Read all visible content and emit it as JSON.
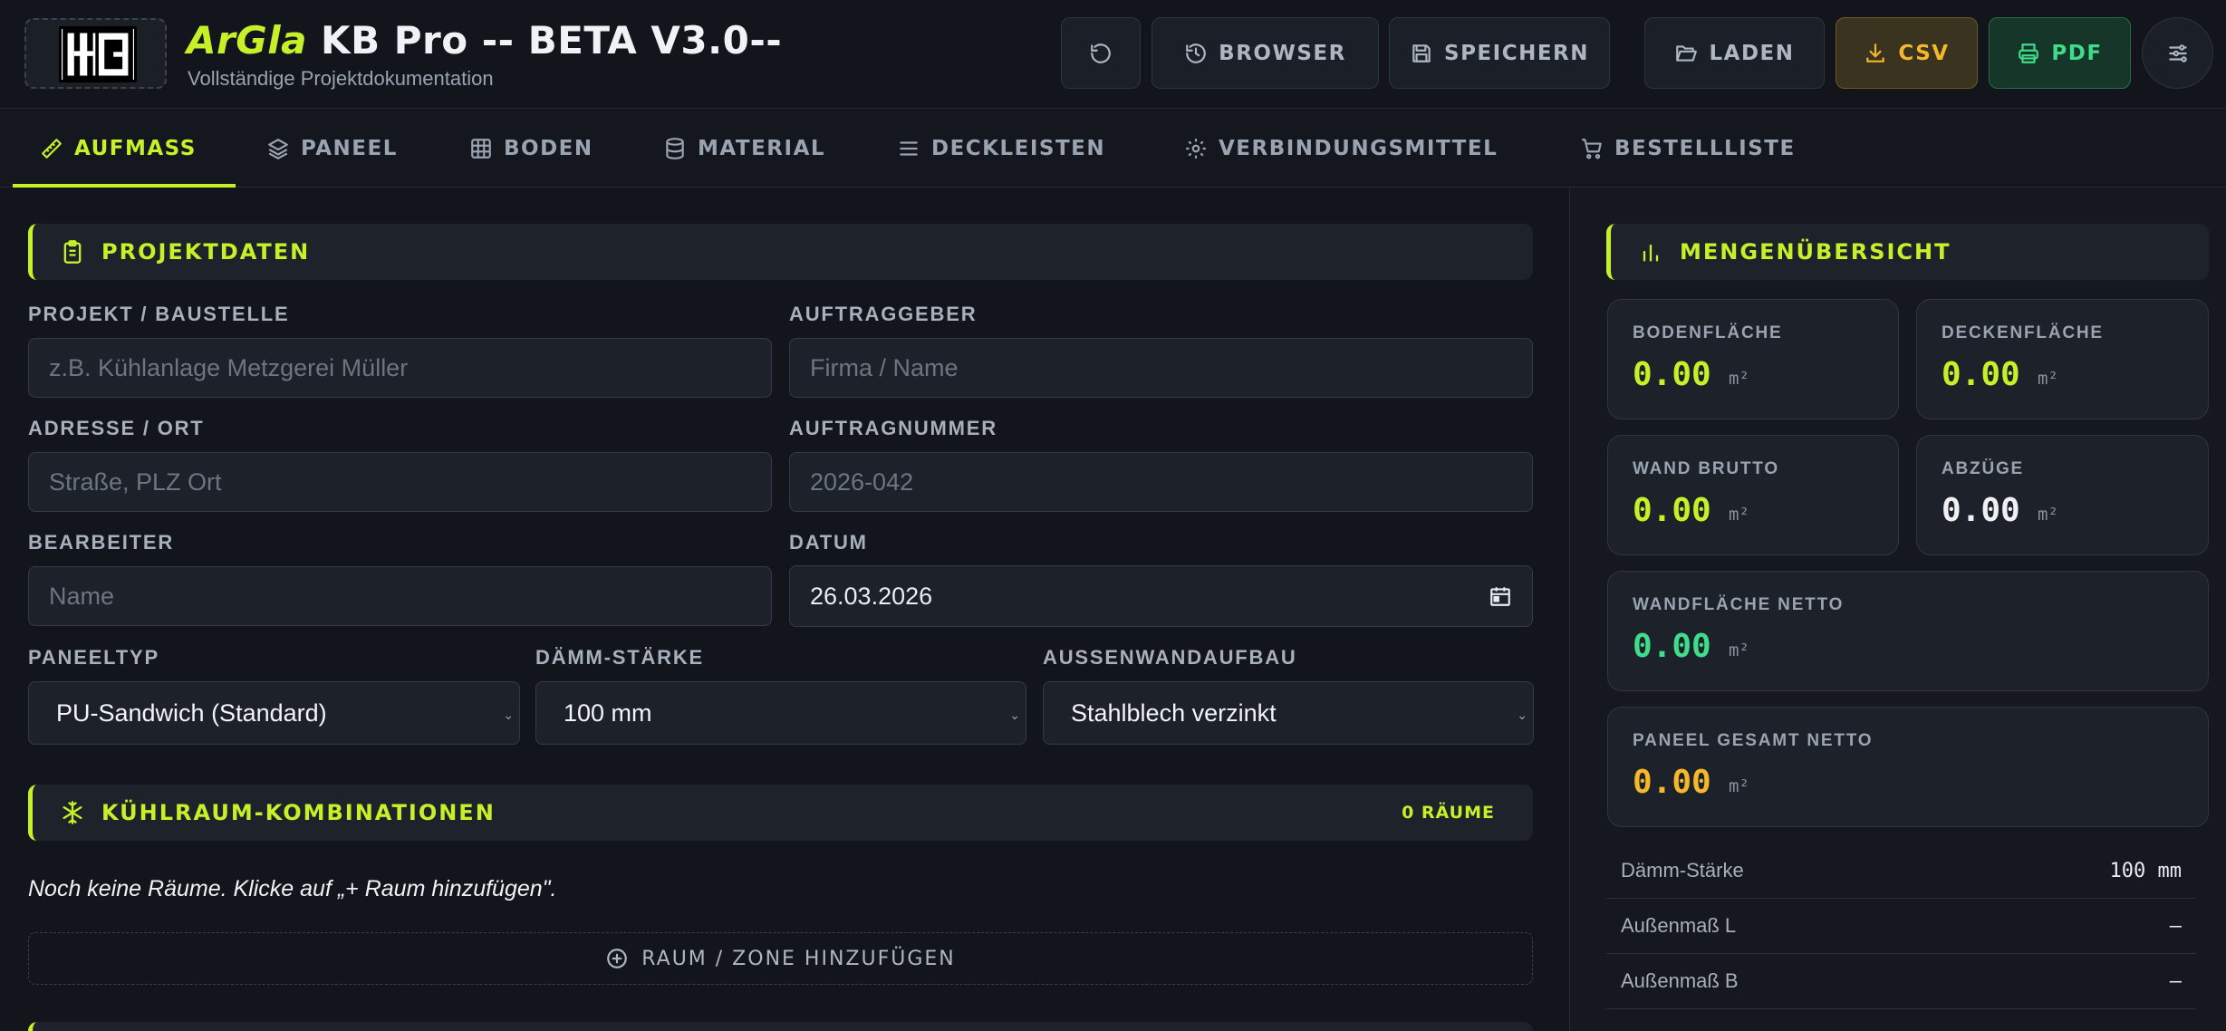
{
  "header": {
    "brand": "ArGla",
    "title_rest": " KB Pro -- BETA V3.0--",
    "subtitle": "Vollständige Projektdokumentation",
    "buttons": {
      "browser": "BROWSER",
      "save": "SPEICHERN",
      "load": "LADEN",
      "csv": "CSV",
      "pdf": "PDF"
    }
  },
  "tabs": [
    {
      "label": "AUFMASS",
      "icon": "ruler-icon",
      "active": true
    },
    {
      "label": "PANEEL",
      "icon": "layers-icon"
    },
    {
      "label": "BODEN",
      "icon": "grid-icon"
    },
    {
      "label": "MATERIAL",
      "icon": "database-icon"
    },
    {
      "label": "DECKLEISTEN",
      "icon": "lines-icon"
    },
    {
      "label": "VERBINDUNGSMITTEL",
      "icon": "gear-icon"
    },
    {
      "label": "BESTELLLISTE",
      "icon": "cart-icon"
    }
  ],
  "projekt": {
    "heading": "PROJEKTDATEN",
    "projekt_label": "PROJEKT / BAUSTELLE",
    "projekt_placeholder": "z.B. Kühlanlage Metzgerei Müller",
    "auftraggeber_label": "AUFTRAGGEBER",
    "auftraggeber_placeholder": "Firma / Name",
    "adresse_label": "ADRESSE / ORT",
    "adresse_placeholder": "Straße, PLZ Ort",
    "auftragnummer_label": "AUFTRAGNUMMER",
    "auftragnummer_placeholder": "2026-042",
    "bearbeiter_label": "BEARBEITER",
    "bearbeiter_placeholder": "Name",
    "datum_label": "DATUM",
    "datum_value": "26.03.2026",
    "paneeltyp_label": "PANEELTYP",
    "paneeltyp_value": "PU-Sandwich (Standard)",
    "daemm_label": "DÄMM-STÄRKE",
    "daemm_value": "100 mm",
    "aussen_label": "AUSSENWANDAUFBAU",
    "aussen_value": "Stahlblech verzinkt"
  },
  "kuehlraum": {
    "heading": "KÜHLRAUM-KOMBINATIONEN",
    "count": "0 RÄUME",
    "empty_note": "Noch keine Räume. Klicke auf „+ Raum hinzufügen\".",
    "add_label": "RAUM / ZONE HINZUFÜGEN"
  },
  "summary": {
    "heading": "MENGENÜBERSICHT",
    "unit": "m²",
    "cards": {
      "bodenflaeche": {
        "label": "BODENFLÄCHE",
        "value": "0.00",
        "color": "#c6f128"
      },
      "deckenflaeche": {
        "label": "DECKENFLÄCHE",
        "value": "0.00",
        "color": "#c6f128"
      },
      "wand_brutto": {
        "label": "WAND BRUTTO",
        "value": "0.00",
        "color": "#c6f128"
      },
      "abzuege": {
        "label": "ABZÜGE",
        "value": "0.00",
        "color": "#eef0f4"
      },
      "wand_netto": {
        "label": "WANDFLÄCHE NETTO",
        "value": "0.00",
        "color": "#3fdc8a"
      },
      "paneel_netto": {
        "label": "PANEEL GESAMT NETTO",
        "value": "0.00",
        "color": "#f5b82a"
      }
    },
    "rows": [
      {
        "label": "Dämm-Stärke",
        "value": "100 mm"
      },
      {
        "label": "Außenmaß L",
        "value": "–"
      },
      {
        "label": "Außenmaß B",
        "value": "–"
      }
    ]
  }
}
